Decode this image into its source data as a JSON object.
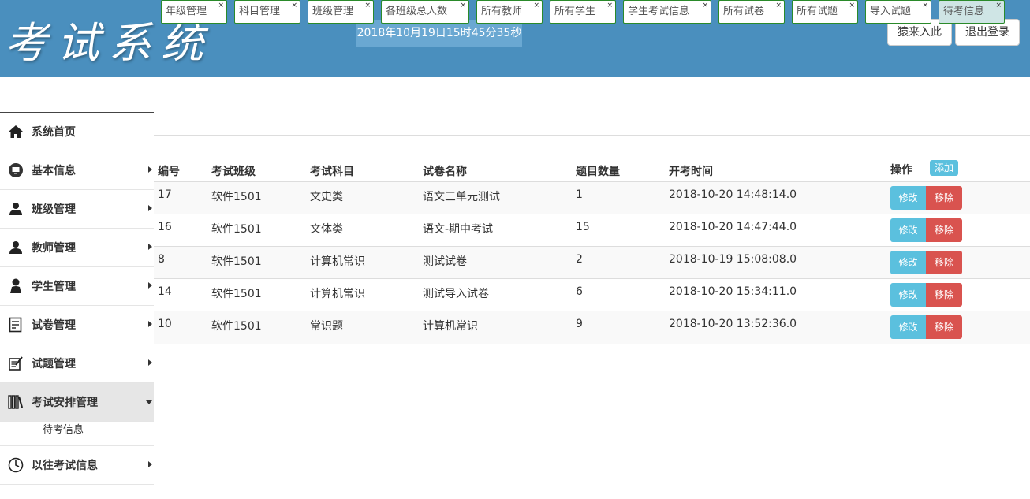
{
  "header": {
    "logo": "考试系统",
    "clock": "2018年10月19日15时45分35秒",
    "enter_button": "猿来入此",
    "logout_button": "退出登录"
  },
  "sidebar": {
    "items": [
      {
        "label": "系统首页",
        "icon": "home-icon"
      },
      {
        "label": "基本信息",
        "icon": "monitor-icon"
      },
      {
        "label": "班级管理",
        "icon": "user-icon"
      },
      {
        "label": "教师管理",
        "icon": "user-icon"
      },
      {
        "label": "学生管理",
        "icon": "user-icon"
      },
      {
        "label": "试卷管理",
        "icon": "document-icon"
      },
      {
        "label": "试题管理",
        "icon": "exam-icon"
      },
      {
        "label": "考试安排管理",
        "icon": "books-icon"
      },
      {
        "label": "以往考试信息",
        "icon": "clock-icon"
      }
    ],
    "sub_item": "待考信息"
  },
  "tabs": [
    "年级管理",
    "科目管理",
    "班级管理",
    "各班级总人数",
    "所有教师",
    "所有学生",
    "学生考试信息",
    "所有试卷",
    "所有试题",
    "导入试题",
    "待考信息"
  ],
  "table": {
    "headers": {
      "id": "编号",
      "class": "考试班级",
      "subject": "考试科目",
      "paper": "试卷名称",
      "count": "题目数量",
      "time": "开考时间",
      "ops": "操作",
      "add": "添加"
    },
    "edit_label": "修改",
    "delete_label": "移除",
    "rows": [
      {
        "id": "17",
        "class": "软件1501",
        "subject": "文史类",
        "paper": "语文三单元测试",
        "count": "1",
        "time": "2018-10-20 14:48:14.0"
      },
      {
        "id": "16",
        "class": "软件1501",
        "subject": "文体类",
        "paper": "语文-期中考试",
        "count": "15",
        "time": "2018-10-20 14:47:44.0"
      },
      {
        "id": "8",
        "class": "软件1501",
        "subject": "计算机常识",
        "paper": "测试试卷",
        "count": "2",
        "time": "2018-10-19 15:08:08.0"
      },
      {
        "id": "14",
        "class": "软件1501",
        "subject": "计算机常识",
        "paper": "测试导入试卷",
        "count": "6",
        "time": "2018-10-20 15:34:11.0"
      },
      {
        "id": "10",
        "class": "软件1501",
        "subject": "常识题",
        "paper": "计算机常识",
        "count": "9",
        "time": "2018-10-20 13:52:36.0"
      }
    ]
  },
  "colors": {
    "header_bg": "#4a8fbe",
    "edit_btn": "#5bc0de",
    "delete_btn": "#d9534f",
    "tab_border": "#2a8a2a",
    "active_tab": "#cfe5e5"
  }
}
